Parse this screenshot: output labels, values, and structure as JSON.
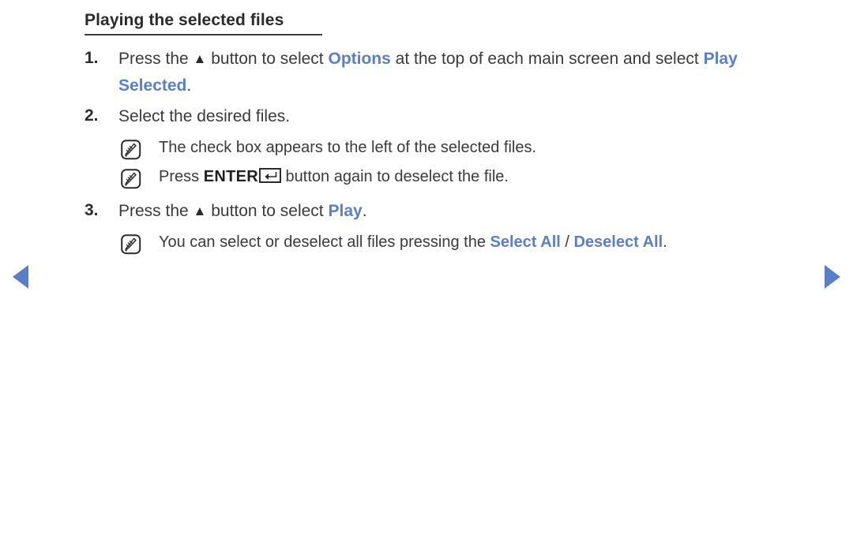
{
  "document": {
    "heading": "Playing the selected files",
    "accent_color": "#5b7fc7",
    "text_color": "#3a3a3a",
    "background_color": "#ffffff"
  },
  "steps": [
    {
      "number": "1.",
      "prefix": "Press the ",
      "triangle": "▲",
      "mid": " button to select ",
      "keyword1": "Options",
      "after1": " at the top of each main screen and select ",
      "keyword2": "Play Selected",
      "after2": "."
    },
    {
      "number": "2.",
      "text": "Select the desired files."
    },
    {
      "number": "3.",
      "prefix": "Press the ",
      "triangle": "▲",
      "mid": " button to select ",
      "keyword1": "Play",
      "after1": "."
    }
  ],
  "notes": [
    {
      "icon": "note-pencil-icon",
      "text": "The check box appears to the left of the selected files."
    },
    {
      "icon": "note-pencil-icon",
      "prefix": "Press ",
      "key_label": "ENTER",
      "key_glyph": "enter-return-key",
      "suffix": " button again to deselect the file."
    },
    {
      "icon": "note-pencil-icon",
      "prefix": "You can select or deselect all files pressing the ",
      "keyword1": "Select All",
      "separator": " / ",
      "keyword2": "Deselect All",
      "suffix": "."
    }
  ],
  "navigation": {
    "prev_label": "Previous page",
    "prev_icon": "triangle-left-icon",
    "next_label": "Next page",
    "next_icon": "triangle-right-icon"
  }
}
